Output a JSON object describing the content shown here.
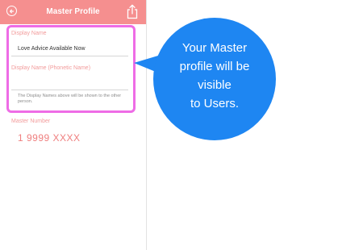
{
  "navbar": {
    "title": "Master Profile"
  },
  "form": {
    "display_name_label": "Display Name",
    "display_name_value": "Love Advice Available Now",
    "phonetic_label": "Display Name (Phonetic Name)",
    "phonetic_value": "",
    "note": "The Display Names above will be shown to the other person."
  },
  "master": {
    "label": "Master Number",
    "value": "1 9999 XXXX"
  },
  "callout": {
    "text_lines": [
      "Your Master",
      "profile will be",
      "visible",
      "to Users."
    ]
  },
  "colors": {
    "navbar": "#f58f8f",
    "highlight_border": "#ee6ce6",
    "callout_fill": "#1e86f2",
    "label_text": "#f29b9b",
    "master_number_text": "#ef7e7e"
  },
  "icons": {
    "back": "back-arrow-circle-icon",
    "share": "share-icon"
  }
}
